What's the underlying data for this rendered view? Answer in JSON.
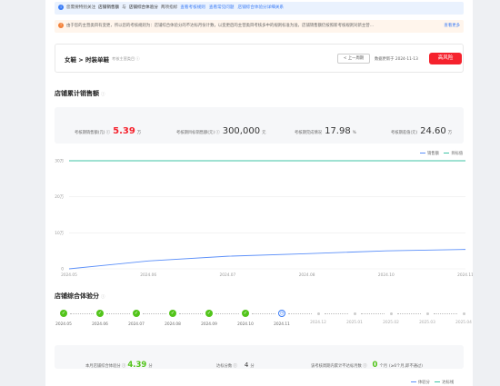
{
  "info_bar": {
    "text_1": "您需要特别关注",
    "text_2": "店铺销售额",
    "text_3": "与",
    "text_4": "店铺综合体验分",
    "text_5": "两项指标",
    "links": [
      "查看考核规则",
      "查看常见问题",
      "店铺综合体验分详细关系"
    ]
  },
  "warn_bar": {
    "text": "由于您的主营类目有变更，所以您的考核规则为：店铺综合体验分的不达标月份计数，以变更后的主营类目考核多中的规则标准为准，店铺销售额仍按照新考核规则对新主营…",
    "link": "查看更多"
  },
  "category": {
    "path": "女鞋 > 时装单鞋",
    "subtitle": "考核主营类目",
    "prev_button": "< 上一周期",
    "updated_label": "数据更新于",
    "updated_date": "2024-11-13",
    "risk_label": "高风险"
  },
  "sales": {
    "title": "店铺累计销售额",
    "metrics": [
      {
        "label": "考核期销售额(元)",
        "value": "5.39",
        "unit": "万"
      },
      {
        "label": "考核期目标销售额(元)",
        "value": "300,000",
        "unit": "元"
      },
      {
        "label": "考核期完成情况",
        "value": "17.98",
        "unit": "%"
      },
      {
        "label": "考核期差值(元)",
        "value": "24.60",
        "unit": "万"
      }
    ]
  },
  "chart_data": {
    "type": "line",
    "x": [
      "2024.05",
      "2024.06",
      "2024.07",
      "2024.08",
      "2024.10",
      "2024.11"
    ],
    "y_ticks": [
      "0",
      "10万",
      "20万",
      "30万"
    ],
    "ylim": [
      0,
      300000
    ],
    "legend_position": "top-right",
    "grid": true,
    "series": [
      {
        "name": "销售额",
        "color": "#5b8ff9",
        "values": [
          0,
          22000,
          35000,
          42000,
          50000,
          53900
        ]
      },
      {
        "name": "目标值",
        "color": "#3fc3a6",
        "values": [
          300000,
          300000,
          300000,
          300000,
          300000,
          300000
        ]
      }
    ]
  },
  "score": {
    "title": "店铺综合体验分",
    "timeline": [
      {
        "label": "2024.05",
        "state": "done"
      },
      {
        "label": "2024.06",
        "state": "done"
      },
      {
        "label": "2024.07",
        "state": "done"
      },
      {
        "label": "2024.08",
        "state": "done"
      },
      {
        "label": "2024.09",
        "state": "done"
      },
      {
        "label": "2024.10",
        "state": "done"
      },
      {
        "label": "2024.11",
        "state": "current"
      },
      {
        "label": "2024.12",
        "state": "todo"
      },
      {
        "label": "2025.01",
        "state": "todo"
      },
      {
        "label": "2025.02",
        "state": "todo"
      },
      {
        "label": "2025.03",
        "state": "todo"
      },
      {
        "label": "2025.04",
        "state": "todo"
      }
    ],
    "stats": {
      "current_label": "本月店铺综合体验分",
      "current_value": "4.39",
      "current_unit": "分",
      "threshold_label": "达标分数",
      "threshold_value": "4",
      "threshold_unit": "分",
      "fail_label": "该考核周期内累计不达标月数",
      "fail_value": "0",
      "fail_unit": "个月",
      "fail_note": "(≥6个月,即不通过)"
    }
  },
  "bottom_legend": [
    "体验分",
    "达标线"
  ],
  "colors": {
    "red": "#f5222d",
    "green": "#52c41a",
    "blue": "#3a7cf6",
    "teal": "#3fc3a6"
  }
}
